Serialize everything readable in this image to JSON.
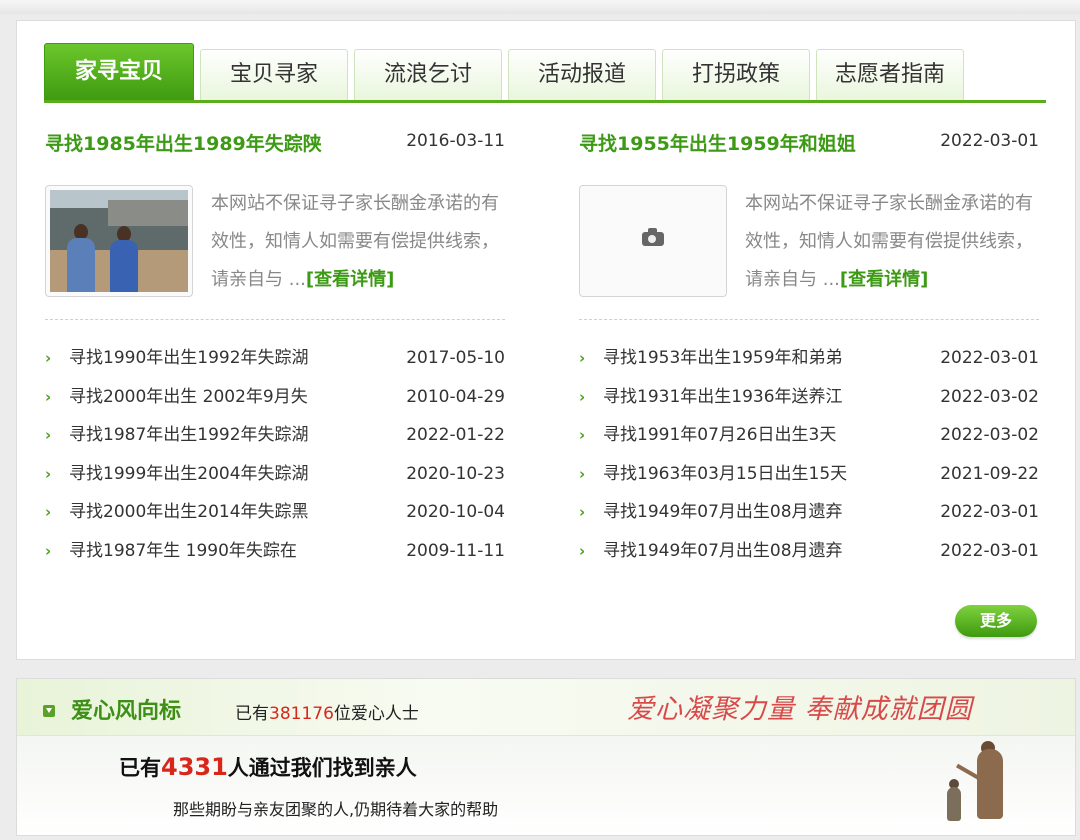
{
  "tabs": [
    {
      "label": "家寻宝贝",
      "active": true
    },
    {
      "label": "宝贝寻家",
      "active": false
    },
    {
      "label": "流浪乞讨",
      "active": false
    },
    {
      "label": "活动报道",
      "active": false
    },
    {
      "label": "打拐政策",
      "active": false
    },
    {
      "label": "志愿者指南",
      "active": false
    }
  ],
  "columns": [
    {
      "feature": {
        "title": "寻找1985年出生1989年失踪陕",
        "date": "2016-03-11",
        "excerpt": "本网站不保证寻子家长酬金承诺的有效性，知情人如需要有偿提供线索，请亲自与 ...",
        "more_label": "[查看详情]",
        "image": "family-photo"
      },
      "items": [
        {
          "title": "寻找1990年出生1992年失踪湖",
          "date": "2017-05-10"
        },
        {
          "title": "寻找2000年出生 2002年9月失",
          "date": "2010-04-29"
        },
        {
          "title": "寻找1987年出生1992年失踪湖",
          "date": "2022-01-22"
        },
        {
          "title": "寻找1999年出生2004年失踪湖",
          "date": "2020-10-23"
        },
        {
          "title": "寻找2000年出生2014年失踪黑",
          "date": "2020-10-04"
        },
        {
          "title": "寻找1987年生 1990年失踪在",
          "date": "2009-11-11"
        }
      ]
    },
    {
      "feature": {
        "title": "寻找1955年出生1959年和姐姐",
        "date": "2022-03-01",
        "excerpt": "本网站不保证寻子家长酬金承诺的有效性，知情人如需要有偿提供线索，请亲自与 ...",
        "more_label": "[查看详情]",
        "image": "camera-icon"
      },
      "items": [
        {
          "title": "寻找1953年出生1959年和弟弟",
          "date": "2022-03-01"
        },
        {
          "title": "寻找1931年出生1936年送养江",
          "date": "2022-03-02"
        },
        {
          "title": "寻找1991年07月26日出生3天",
          "date": "2022-03-02"
        },
        {
          "title": "寻找1963年03月15日出生15天",
          "date": "2021-09-22"
        },
        {
          "title": "寻找1949年07月出生08月遗弃",
          "date": "2022-03-01"
        },
        {
          "title": "寻找1949年07月出生08月遗弃",
          "date": "2022-03-01"
        }
      ]
    }
  ],
  "more_button": "更多",
  "love": {
    "title": "爱心风向标",
    "count_prefix": "已有",
    "count_num": "381176",
    "count_suffix": "位爱心人士",
    "slogan": "爱心凝聚力量  奉献成就团圆",
    "found_prefix": "已有",
    "found_num": "4331",
    "found_suffix": "人通过我们找到亲人",
    "subtitle": "那些期盼与亲友团聚的人,仍期待着大家的帮助"
  },
  "colors": {
    "accent": "#4aa31a",
    "highlight": "#d8261a"
  }
}
